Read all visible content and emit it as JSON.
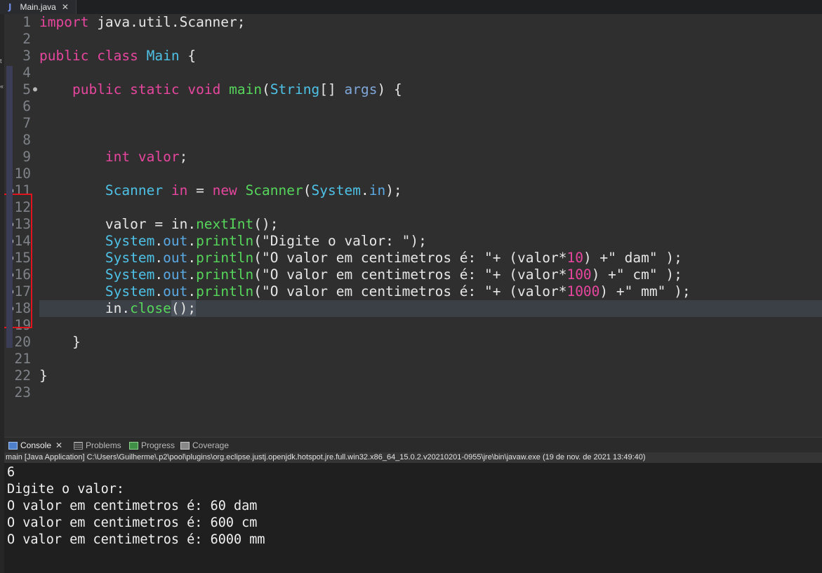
{
  "editor_tab": {
    "icon": "J",
    "title": "Main.java",
    "close": "✕"
  },
  "code_lines": [
    {
      "n": "1",
      "t": [
        [
          "kw",
          "import"
        ],
        [
          "id",
          " java.util.Scanner;"
        ]
      ]
    },
    {
      "n": "2",
      "t": []
    },
    {
      "n": "3",
      "t": [
        [
          "kw",
          "public"
        ],
        [
          "id",
          " "
        ],
        [
          "kw",
          "class"
        ],
        [
          "id",
          " "
        ],
        [
          "ty",
          "Main"
        ],
        [
          "id",
          " {"
        ]
      ]
    },
    {
      "n": "4",
      "t": []
    },
    {
      "n": "5",
      "fold": true,
      "t": [
        [
          "id",
          "    "
        ],
        [
          "kw",
          "public"
        ],
        [
          "id",
          " "
        ],
        [
          "kw",
          "static"
        ],
        [
          "id",
          " "
        ],
        [
          "kw",
          "void"
        ],
        [
          "id",
          " "
        ],
        [
          "fn",
          "main"
        ],
        [
          "id",
          "("
        ],
        [
          "ty",
          "String"
        ],
        [
          "id",
          "[] "
        ],
        [
          "prm",
          "args"
        ],
        [
          "id",
          ") {"
        ]
      ]
    },
    {
      "n": "6",
      "t": []
    },
    {
      "n": "7",
      "t": []
    },
    {
      "n": "8",
      "t": []
    },
    {
      "n": "9",
      "t": [
        [
          "id",
          "        "
        ],
        [
          "kw",
          "int"
        ],
        [
          "id",
          " "
        ],
        [
          "kw",
          "valor"
        ],
        [
          "id",
          ";"
        ]
      ]
    },
    {
      "n": "10",
      "t": []
    },
    {
      "n": "11",
      "bp": true,
      "t": [
        [
          "id",
          "        "
        ],
        [
          "ty",
          "Scanner"
        ],
        [
          "id",
          " "
        ],
        [
          "kw",
          "in"
        ],
        [
          "id",
          " = "
        ],
        [
          "kw",
          "new"
        ],
        [
          "id",
          " "
        ],
        [
          "fn",
          "Scanner"
        ],
        [
          "id",
          "("
        ],
        [
          "ty",
          "System"
        ],
        [
          "id",
          "."
        ],
        [
          "fld",
          "in"
        ],
        [
          "id",
          ");"
        ]
      ]
    },
    {
      "n": "12",
      "t": []
    },
    {
      "n": "13",
      "bp": true,
      "t": [
        [
          "id",
          "        valor = in."
        ],
        [
          "fn",
          "nextInt"
        ],
        [
          "id",
          "();"
        ]
      ]
    },
    {
      "n": "14",
      "bp": true,
      "t": [
        [
          "id",
          "        "
        ],
        [
          "ty",
          "System"
        ],
        [
          "id",
          "."
        ],
        [
          "fld",
          "out"
        ],
        [
          "id",
          "."
        ],
        [
          "fn",
          "println"
        ],
        [
          "id",
          "("
        ],
        [
          "str",
          "\"Digite o valor: \""
        ],
        [
          "id",
          ");"
        ]
      ]
    },
    {
      "n": "15",
      "bp": true,
      "t": [
        [
          "id",
          "        "
        ],
        [
          "ty",
          "System"
        ],
        [
          "id",
          "."
        ],
        [
          "fld",
          "out"
        ],
        [
          "id",
          "."
        ],
        [
          "fn",
          "println"
        ],
        [
          "id",
          "("
        ],
        [
          "str",
          "\"O valor em centimetros é: \""
        ],
        [
          "id",
          "+ (valor*"
        ],
        [
          "num",
          "10"
        ],
        [
          "id",
          ") +"
        ],
        [
          "str",
          "\" dam\""
        ],
        [
          "id",
          " );"
        ]
      ]
    },
    {
      "n": "16",
      "bp": true,
      "t": [
        [
          "id",
          "        "
        ],
        [
          "ty",
          "System"
        ],
        [
          "id",
          "."
        ],
        [
          "fld",
          "out"
        ],
        [
          "id",
          "."
        ],
        [
          "fn",
          "println"
        ],
        [
          "id",
          "("
        ],
        [
          "str",
          "\"O valor em centimetros é: \""
        ],
        [
          "id",
          "+ (valor*"
        ],
        [
          "num",
          "100"
        ],
        [
          "id",
          ") +"
        ],
        [
          "str",
          "\" cm\""
        ],
        [
          "id",
          " );"
        ]
      ]
    },
    {
      "n": "17",
      "bp": true,
      "t": [
        [
          "id",
          "        "
        ],
        [
          "ty",
          "System"
        ],
        [
          "id",
          "."
        ],
        [
          "fld",
          "out"
        ],
        [
          "id",
          "."
        ],
        [
          "fn",
          "println"
        ],
        [
          "id",
          "("
        ],
        [
          "str",
          "\"O valor em centimetros é: \""
        ],
        [
          "id",
          "+ (valor*"
        ],
        [
          "num",
          "1000"
        ],
        [
          "id",
          ") +"
        ],
        [
          "str",
          "\" mm\""
        ],
        [
          "id",
          " );"
        ]
      ]
    },
    {
      "n": "18",
      "bp": true,
      "current": true,
      "t": [
        [
          "id",
          "        in."
        ],
        [
          "fn",
          "close"
        ],
        [
          "id",
          "();"
        ]
      ]
    },
    {
      "n": "19",
      "t": []
    },
    {
      "n": "20",
      "t": [
        [
          "id",
          "    }"
        ]
      ]
    },
    {
      "n": "21",
      "t": []
    },
    {
      "n": "22",
      "t": [
        [
          "id",
          "}"
        ]
      ]
    },
    {
      "n": "23",
      "t": []
    }
  ],
  "console_tabs": [
    {
      "label": "Console",
      "icon": "console-icon",
      "active": true,
      "close": "✕"
    },
    {
      "label": "Problems",
      "icon": "problems-icon"
    },
    {
      "label": "Progress",
      "icon": "progress-icon"
    },
    {
      "label": "Coverage",
      "icon": "coverage-icon"
    }
  ],
  "console_header": "main [Java Application] C:\\Users\\Guilherme\\.p2\\pool\\plugins\\org.eclipse.justj.openjdk.hotspot.jre.full.win32.x86_64_15.0.2.v20210201-0955\\jre\\bin\\javaw.exe  (19 de nov. de 2021 13:49:40)",
  "console_output": [
    "6",
    "Digite o valor:",
    "O valor em centimetros é: 60 dam",
    "O valor em centimetros é: 600 cm",
    "O valor em centimetros é: 6000 mm"
  ],
  "left_strip_fragments": [
    "t",
    "«"
  ],
  "colors": {
    "keyword": "#e7469e",
    "type": "#4ec1e6",
    "method": "#56d65b",
    "breakpoint_box": "#e0141c",
    "current_line": "#3b4047"
  }
}
